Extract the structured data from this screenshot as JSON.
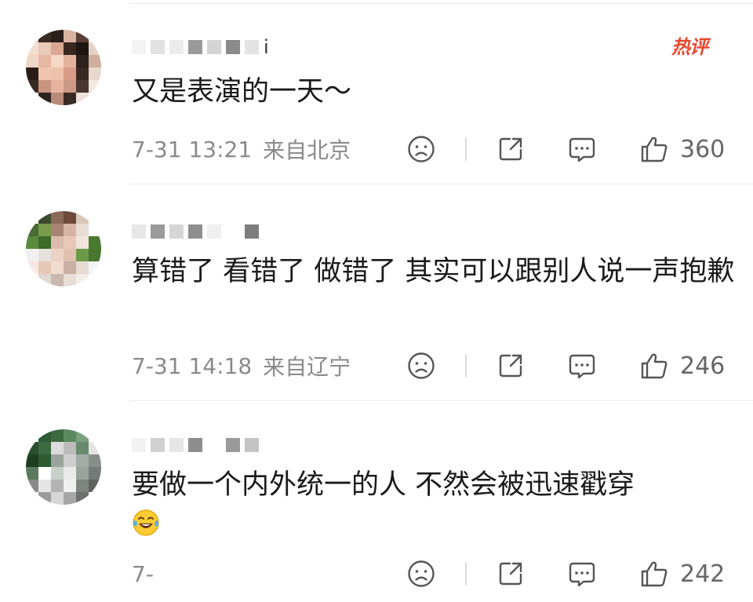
{
  "hot_badge": "热评",
  "comments": [
    {
      "username_tail": "i",
      "text": "又是表演的一天～",
      "time": "7-31 13:21",
      "location": "来自北京",
      "likes": "360"
    },
    {
      "username_tail": "",
      "text": "算错了 看错了 做错了 其实可以跟别人说一声抱歉",
      "time": "7-31 14:18",
      "location": "来自辽宁",
      "likes": "246"
    },
    {
      "username_tail": "",
      "text": "要做一个内外统一的人 不然会被迅速戳穿",
      "time": "7-",
      "location": "",
      "likes": "242",
      "emoji": "laughing-tears-emoji"
    }
  ],
  "icons": {
    "dislike": "sad-face-icon",
    "share": "share-icon",
    "reply": "comment-icon",
    "like": "thumbs-up-icon"
  },
  "colors": {
    "hot_badge": "#e8482f",
    "meta_text": "#8a8a8a",
    "body_text": "#1a1a1a"
  }
}
